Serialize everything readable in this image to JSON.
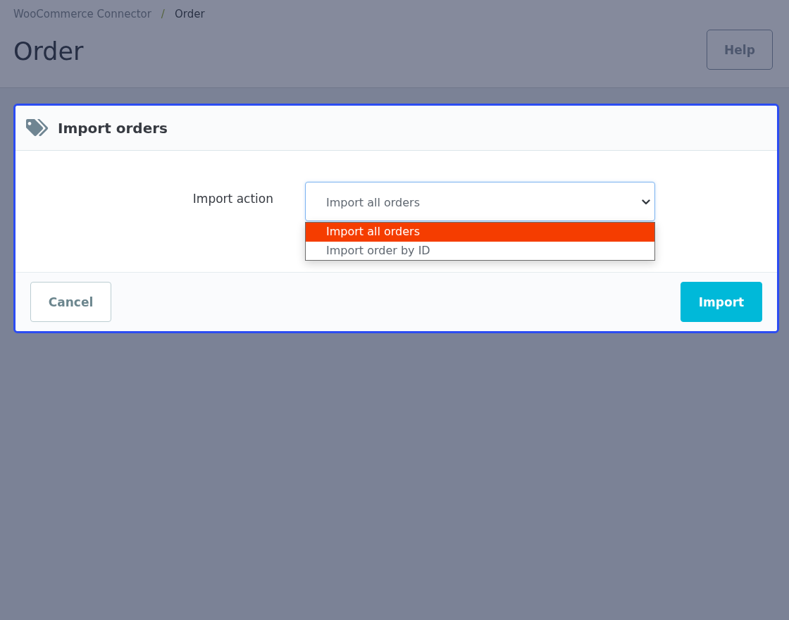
{
  "breadcrumb": {
    "items": [
      {
        "label": "WooCommerce Connector",
        "selected": false
      },
      {
        "label": "Order",
        "selected": true
      }
    ],
    "separator": "/"
  },
  "page_title": "Order",
  "help_button": "Help",
  "modal": {
    "title": "Import orders",
    "field": {
      "label": "Import action",
      "value": "Import all orders",
      "expanded": true,
      "options": [
        {
          "label": "Import all orders",
          "selected": true
        },
        {
          "label": "Import order by ID",
          "selected": false
        }
      ]
    },
    "buttons": [
      {
        "label": "Cancel",
        "kind": "secondary"
      },
      {
        "label": "Import",
        "kind": "primary"
      }
    ]
  }
}
